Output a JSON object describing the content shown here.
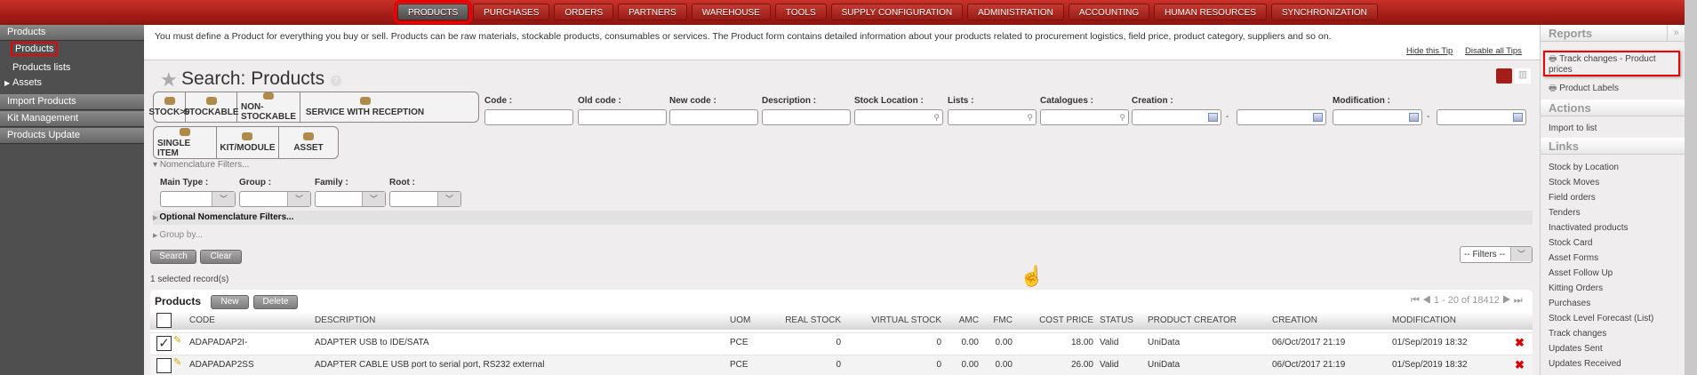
{
  "top_menu": [
    "PRODUCTS",
    "PURCHASES",
    "ORDERS",
    "PARTNERS",
    "WAREHOUSE",
    "TOOLS",
    "SUPPLY CONFIGURATION",
    "ADMINISTRATION",
    "ACCOUNTING",
    "HUMAN RESOURCES",
    "SYNCHRONIZATION"
  ],
  "sidebar": {
    "header": "Products",
    "items": [
      "Products",
      "Products lists",
      "Assets"
    ],
    "sections": [
      "Import Products",
      "Kit Management",
      "Products Update"
    ]
  },
  "tip": {
    "text": "You must define a Product for everything you buy or sell. Products can be raw materials, stockable products, consumables or services. The Product form contains detailed information about your products related to procurement logistics, field price, product category, suppliers and so on.",
    "hide": "Hide this Tip",
    "disable": "Disable all Tips"
  },
  "title": "Search: Products",
  "filter_buttons_1": [
    "STOCK>0",
    "STOCKABLE",
    "NON-STOCKABLE",
    "SERVICE WITH RECEPTION"
  ],
  "filter_buttons_2": [
    "SINGLE ITEM",
    "KIT/MODULE",
    "ASSET"
  ],
  "fields": {
    "code": "Code :",
    "old_code": "Old code :",
    "new_code": "New code :",
    "description": "Description :",
    "stock_location": "Stock Location :",
    "lists": "Lists :",
    "catalogues": "Catalogues :",
    "creation": "Creation :",
    "modification": "Modification :",
    "dash": "-"
  },
  "nomenclature": {
    "toggle": "Nomenclature Filters...",
    "main_type": "Main Type :",
    "group": "Group :",
    "family": "Family :",
    "root": "Root :",
    "optional": "Optional Nomenclature Filters...",
    "group_by": "Group by..."
  },
  "buttons": {
    "search": "Search",
    "clear": "Clear",
    "new": "New",
    "delete": "Delete",
    "filters": "-- Filters --"
  },
  "selected": "1 selected record(s)",
  "table": {
    "title": "Products",
    "pagination": "1 - 20 of 18412",
    "headers": [
      "CODE",
      "DESCRIPTION",
      "UOM",
      "REAL STOCK",
      "VIRTUAL STOCK",
      "AMC",
      "FMC",
      "COST PRICE",
      "STATUS",
      "PRODUCT CREATOR",
      "CREATION",
      "MODIFICATION"
    ],
    "rows": [
      {
        "checked": true,
        "cells": [
          "ADAPADAP2I-",
          "ADAPTER USB to IDE/SATA",
          "PCE",
          "0",
          "0",
          "0.00",
          "0.00",
          "18.00",
          "Valid",
          "UniData",
          "06/Oct/2017 21:19",
          "01/Sep/2019 18:32"
        ]
      },
      {
        "checked": false,
        "cells": [
          "ADAPADAP2SS",
          "ADAPTER CABLE USB port to serial port, RS232 external",
          "PCE",
          "0",
          "0",
          "0.00",
          "0.00",
          "26.00",
          "Valid",
          "UniData",
          "06/Oct/2017 21:19",
          "01/Sep/2019 18:32"
        ]
      }
    ]
  },
  "right_panel": {
    "reports": "Reports",
    "collapse": "»",
    "report_items": [
      "Track changes - Product prices",
      "Product Labels"
    ],
    "actions": "Actions",
    "action_items": [
      "Import to list"
    ],
    "links": "Links",
    "link_items": [
      "Stock by Location",
      "Stock Moves",
      "Field orders",
      "Tenders",
      "Inactivated products",
      "Stock Card",
      "Asset Forms",
      "Asset Follow Up",
      "Kitting Orders",
      "Purchases",
      "Stock Level Forecast (List)",
      "Track changes",
      "Updates Sent",
      "Updates Received"
    ]
  },
  "colors": {
    "brand": "#b0231c",
    "highlight": "#e00000"
  }
}
